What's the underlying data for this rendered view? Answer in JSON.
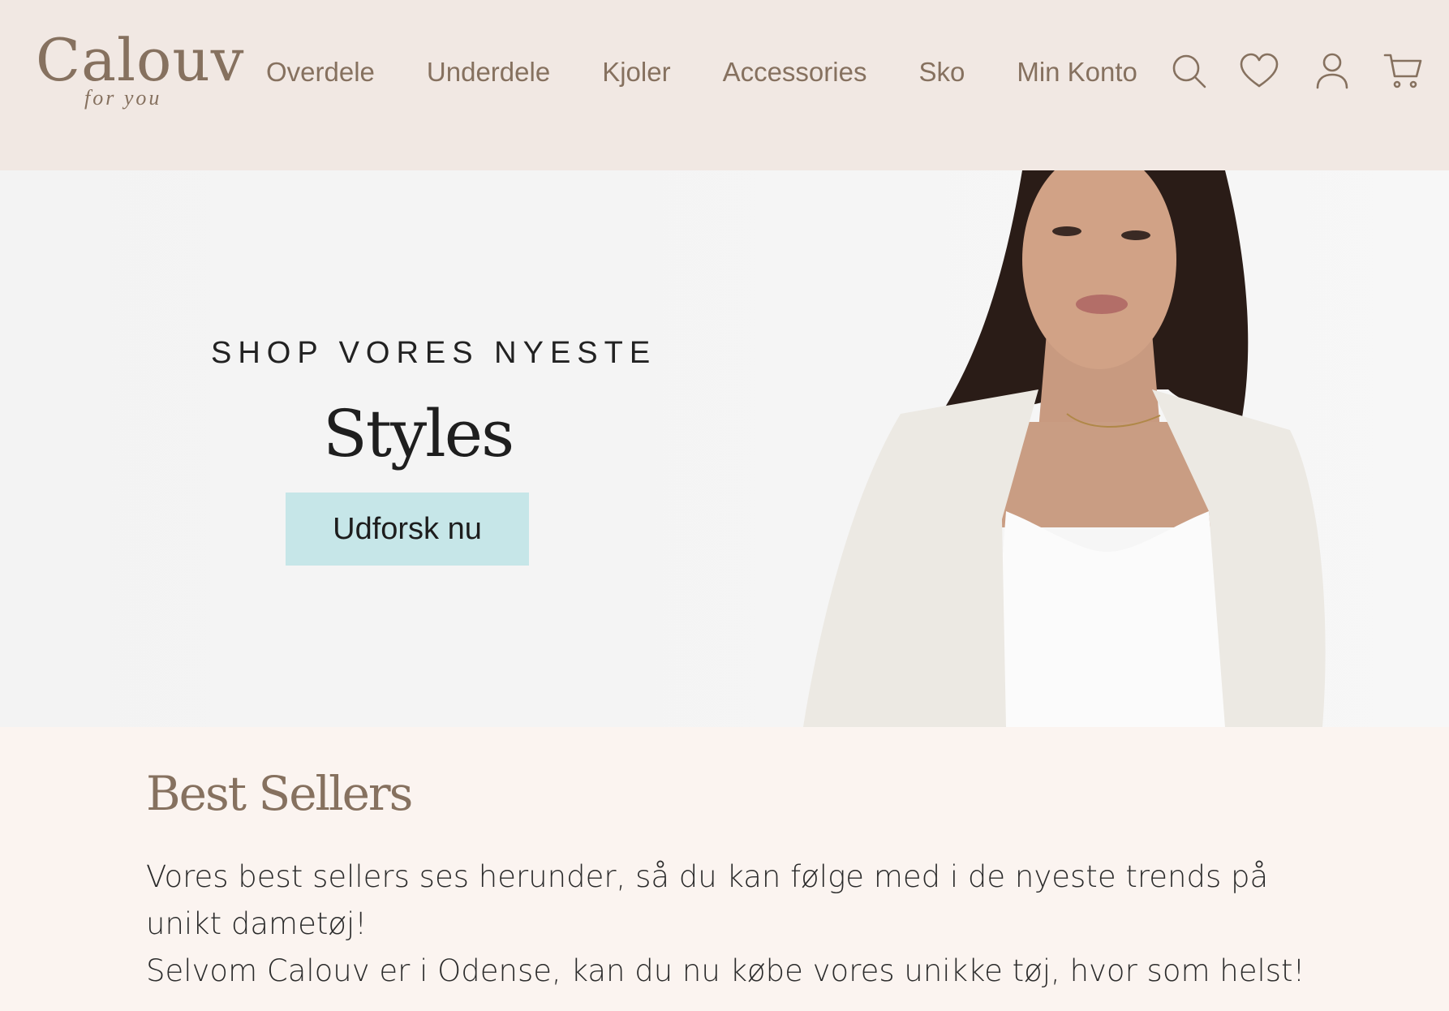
{
  "brand": {
    "name": "Calouv",
    "tagline": "for you"
  },
  "nav": {
    "items": [
      {
        "label": "Overdele"
      },
      {
        "label": "Underdele"
      },
      {
        "label": "Kjoler"
      },
      {
        "label": "Accessories"
      },
      {
        "label": "Sko"
      },
      {
        "label": "Min Konto"
      }
    ]
  },
  "header_icons": [
    "search-icon",
    "heart-icon",
    "user-icon",
    "cart-icon"
  ],
  "hero": {
    "kicker": "SHOP VORES NYESTE",
    "title": "Styles",
    "cta": "Udforsk nu"
  },
  "best_sellers": {
    "title": "Best Sellers",
    "line1": "Vores best sellers ses herunder, så du kan følge med i de nyeste trends på unikt dametøj!",
    "line2": "Selvom Calouv er i Odense, kan du nu købe vores unikke tøj, hvor som helst!"
  },
  "colors": {
    "header_bg": "#f1e8e3",
    "brand_brown": "#86715f",
    "cta_bg": "#c6e6e8",
    "section_bg": "#fbf4f0"
  }
}
